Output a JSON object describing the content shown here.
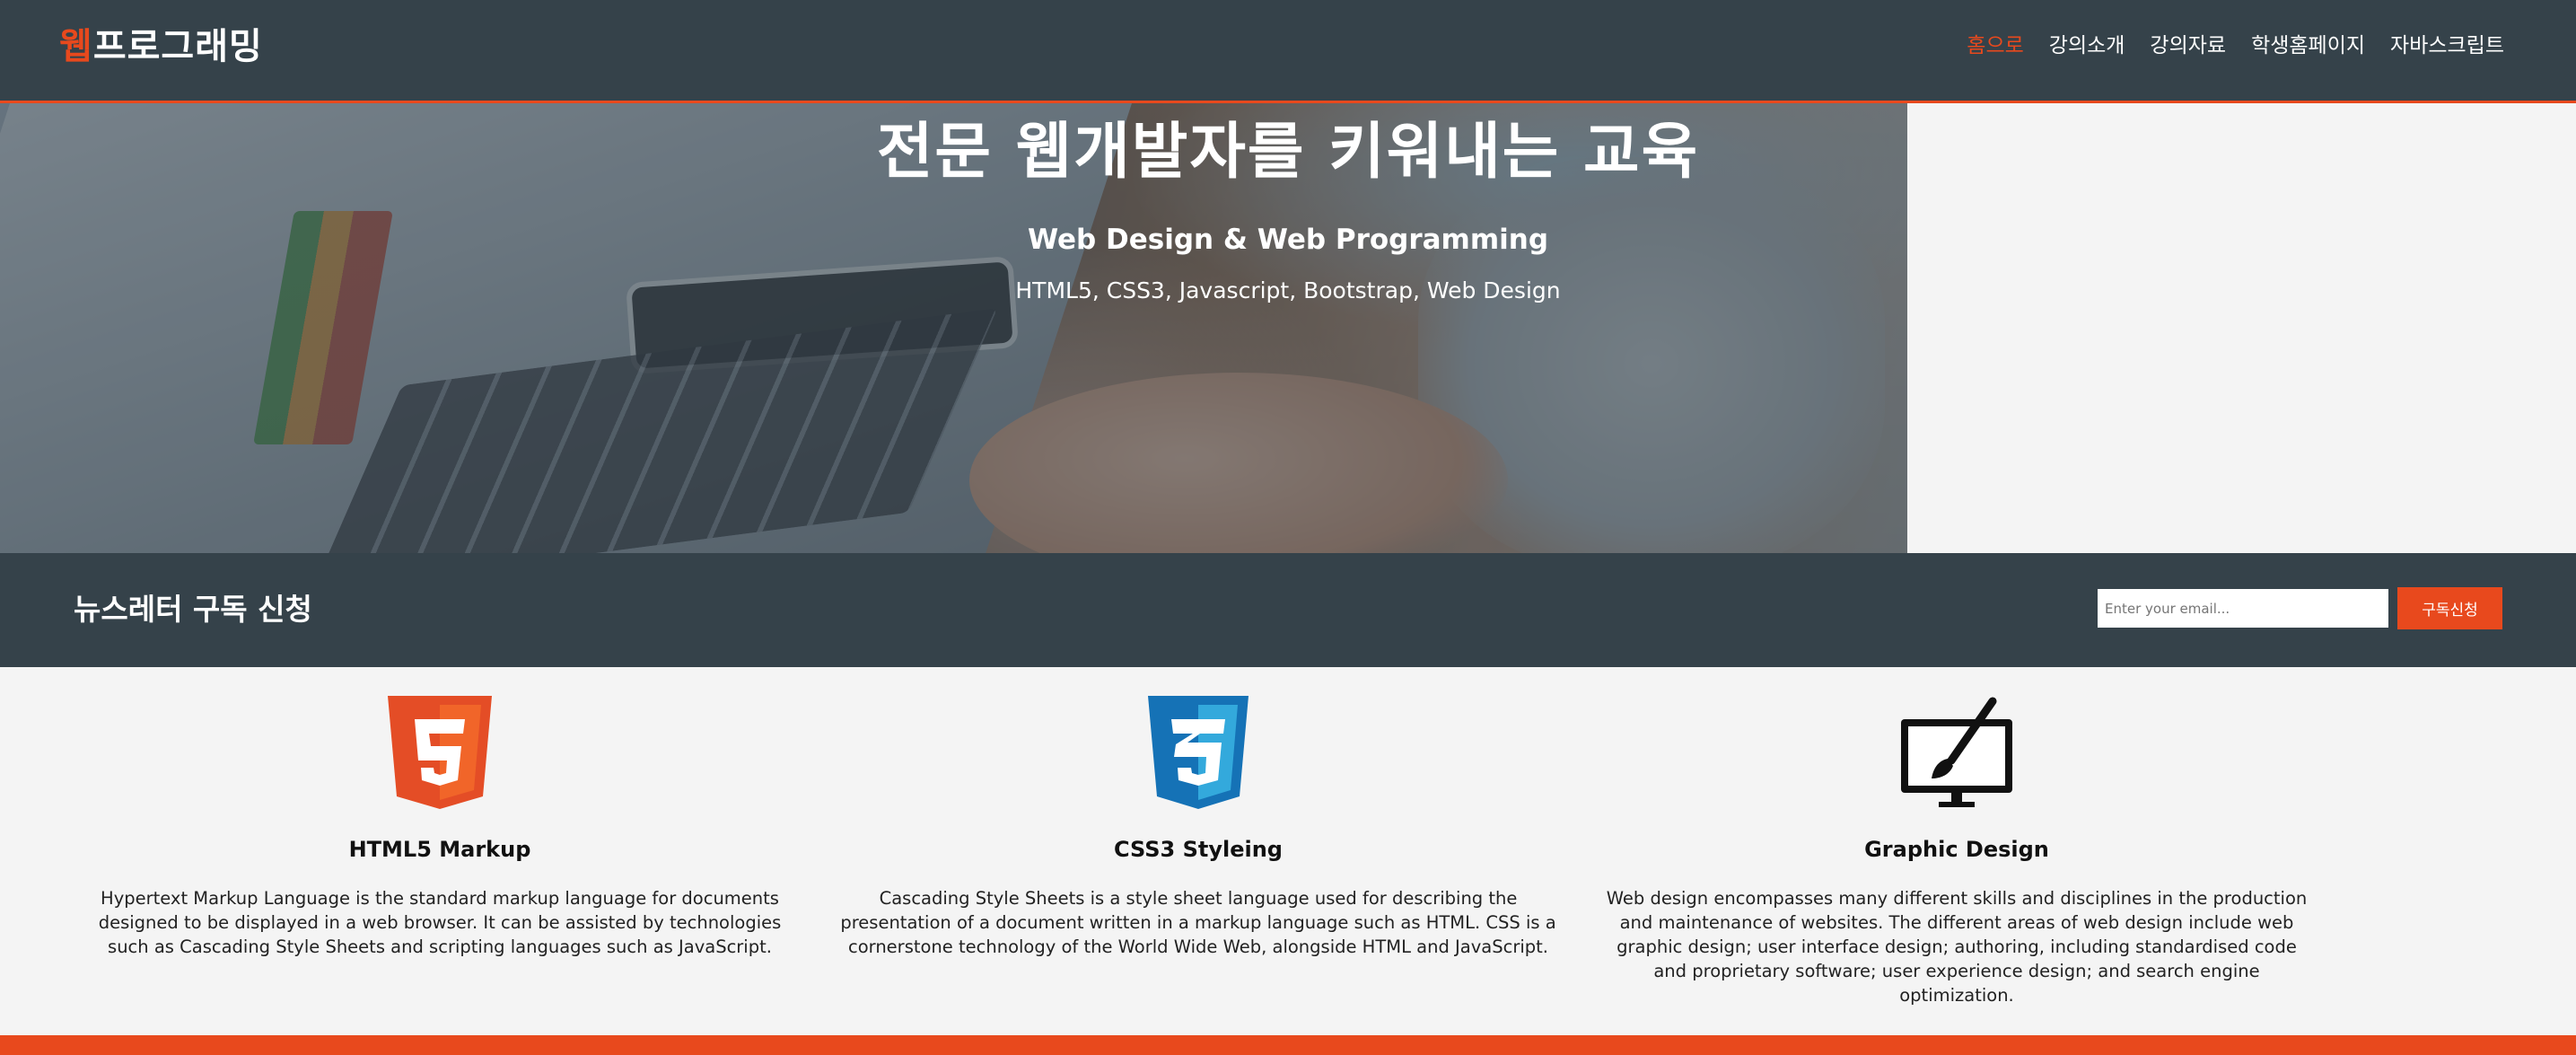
{
  "header": {
    "logo_accent": "웹",
    "logo_rest": "프로그래밍",
    "nav": [
      {
        "label": "홈으로",
        "current": true
      },
      {
        "label": "강의소개",
        "current": false
      },
      {
        "label": "강의자료",
        "current": false
      },
      {
        "label": "학생홈페이지",
        "current": false
      },
      {
        "label": "자바스크립트",
        "current": false
      }
    ]
  },
  "hero": {
    "title": "전문 웹개발자를 키워내는 교육",
    "subtitle": "Web Design & Web Programming",
    "tags": "HTML5, CSS3, Javascript, Bootstrap, Web Design"
  },
  "newsletter": {
    "heading": "뉴스레터 구독 신청",
    "email_placeholder": "Enter your email...",
    "submit_label": "구독신청"
  },
  "boxes": [
    {
      "icon": "html5-logo-icon",
      "title": "HTML5 Markup",
      "text": "Hypertext Markup Language is the standard markup language for documents designed to be displayed in a web browser. It can be assisted by technologies such as Cascading Style Sheets and scripting languages such as JavaScript."
    },
    {
      "icon": "css3-logo-icon",
      "title": "CSS3 Styleing",
      "text": "Cascading Style Sheets is a style sheet language used for describing the presentation of a document written in a markup language such as HTML. CSS is a cornerstone technology of the World Wide Web, alongside HTML and JavaScript."
    },
    {
      "icon": "graphic-design-monitor-brush-icon",
      "title": "Graphic Design",
      "text": "Web design encompasses many different skills and disciplines in the production and maintenance of websites. The different areas of web design include web graphic design; user interface design; authoring, including standardised code and proprietary software; user experience design; and search engine optimization."
    }
  ],
  "colors": {
    "dark": "#35424a",
    "accent": "#e8491d",
    "page_bg": "#f4f4f4",
    "html5_orange": "#e44d26",
    "css3_blue": "#1572b6"
  }
}
